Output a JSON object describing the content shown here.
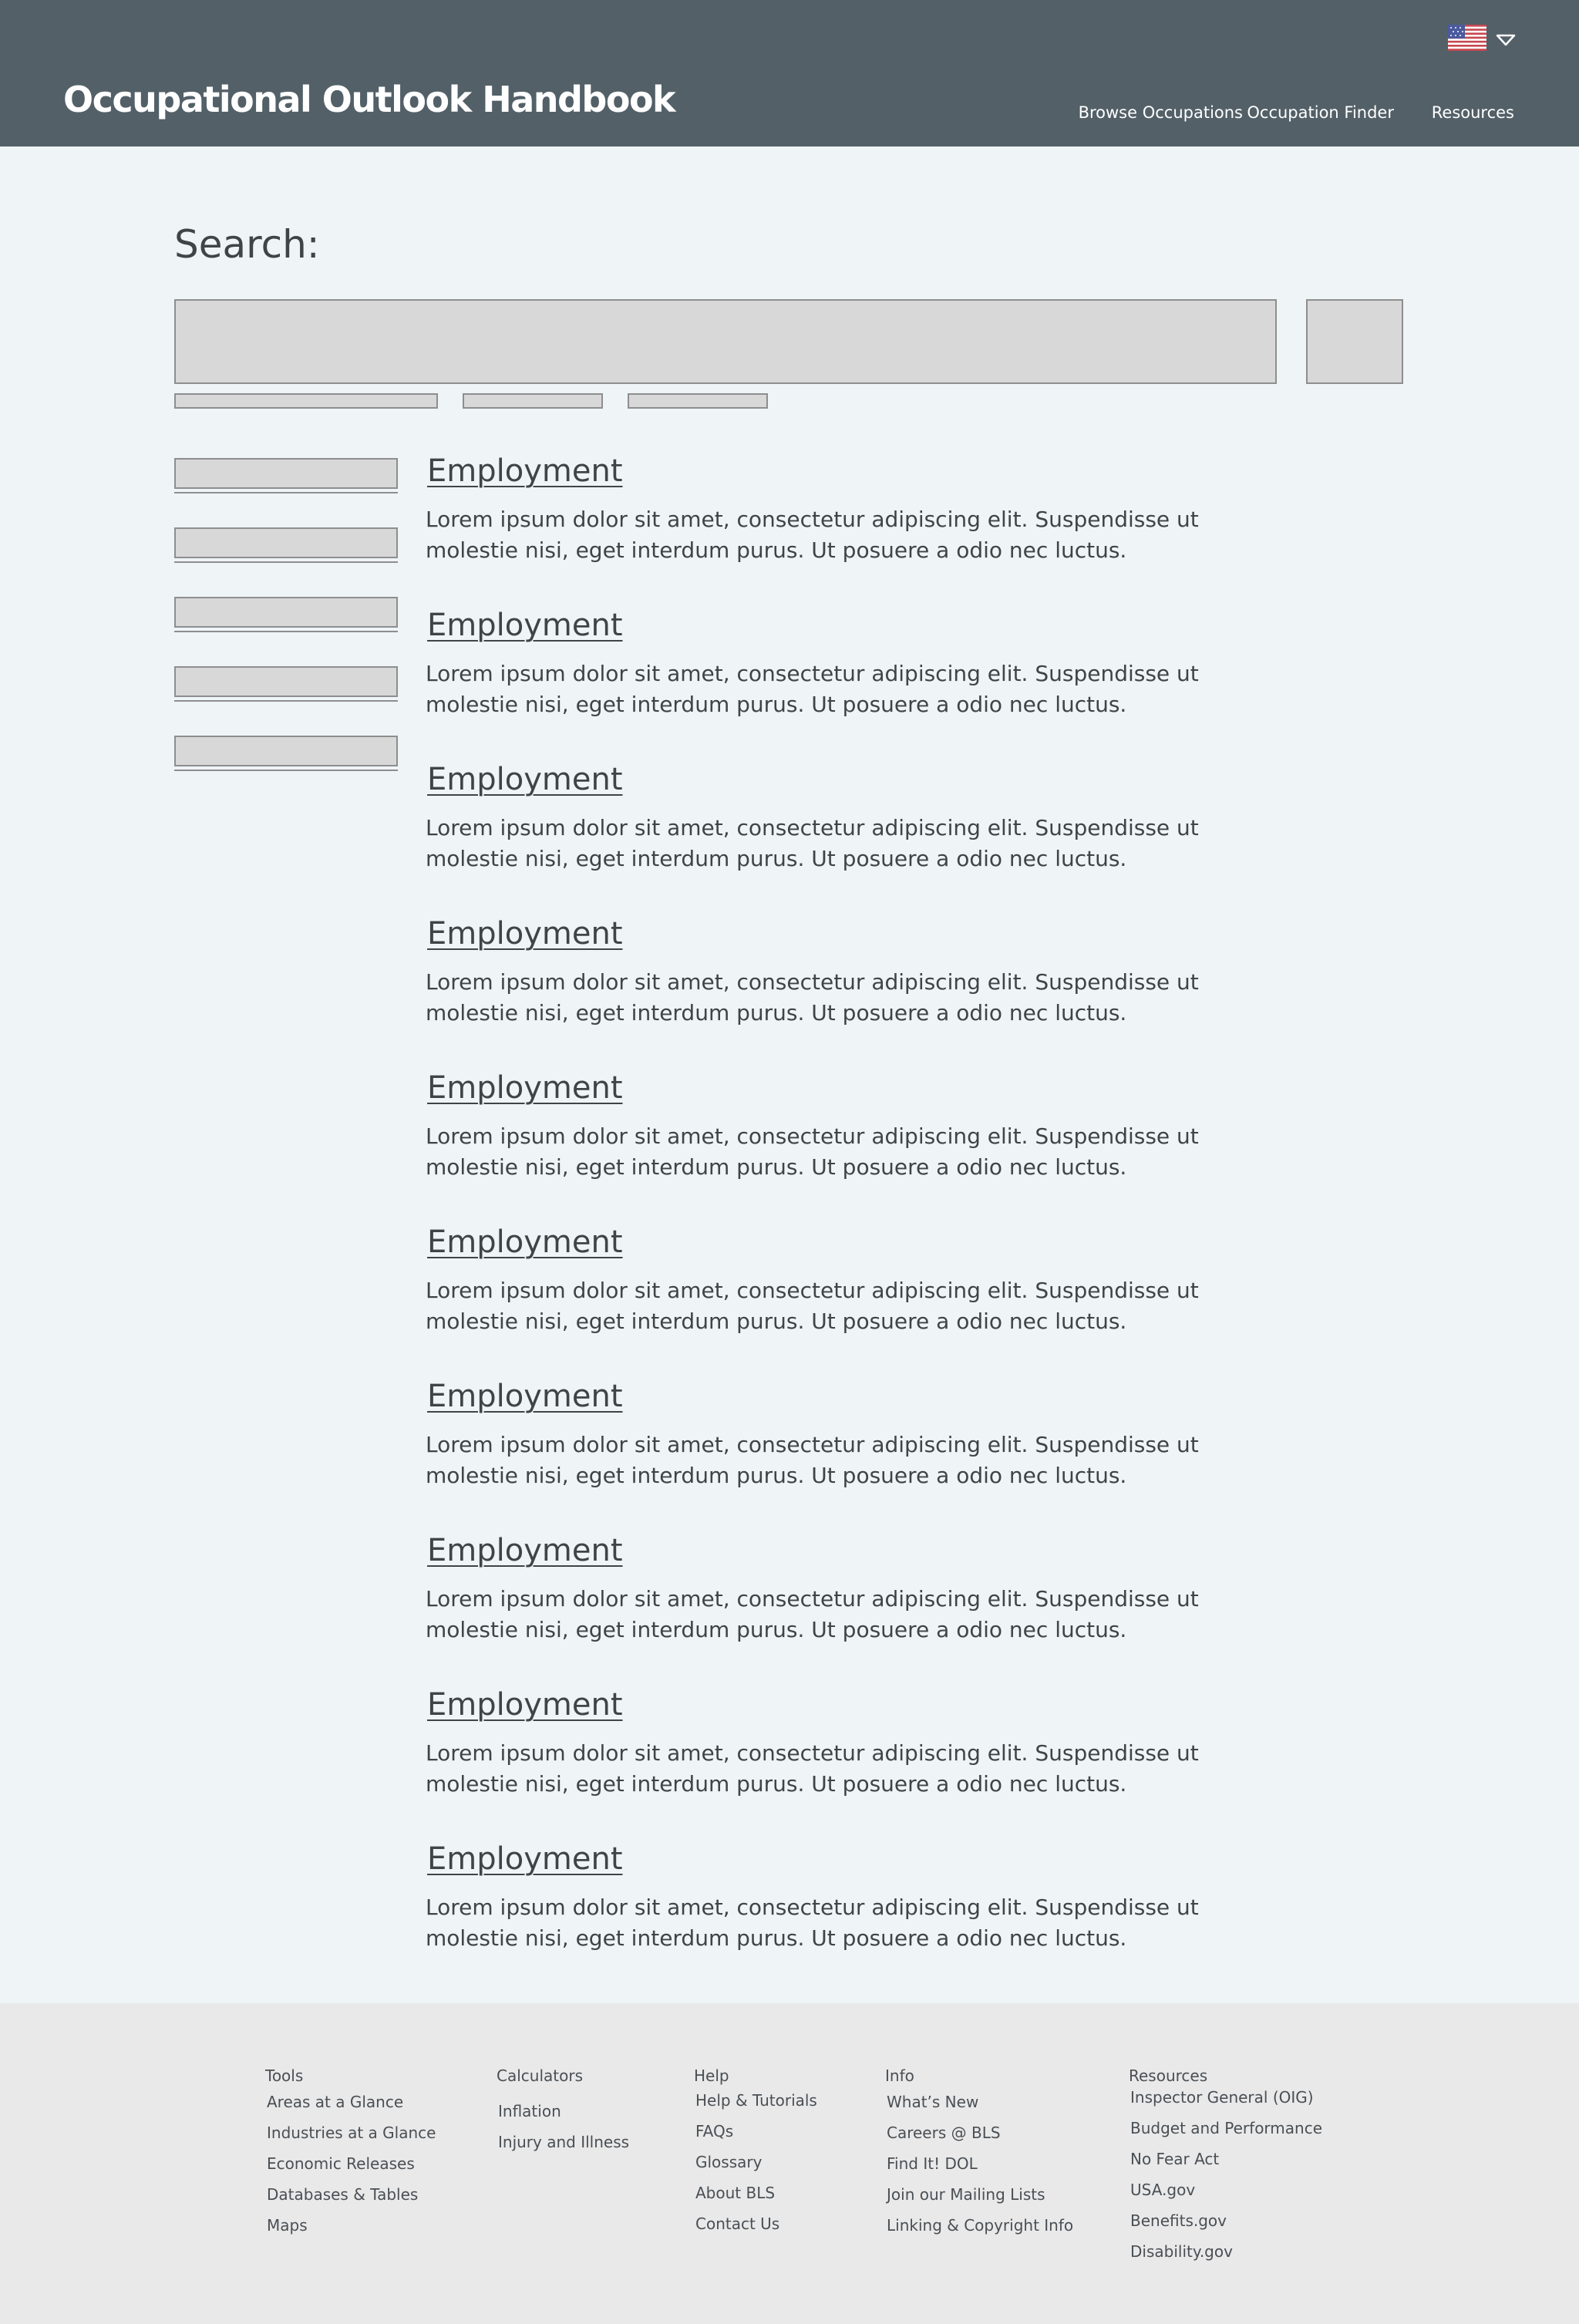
{
  "header": {
    "title": "Occupational Outlook Handbook",
    "nav": [
      "Browse Occupations",
      "Occupation Finder",
      "Resources"
    ]
  },
  "search": {
    "label": "Search:",
    "value": "",
    "placeholder": ""
  },
  "results": [
    {
      "title": "Employment",
      "description": "Lorem ipsum dolor sit amet, consectetur adipiscing elit. Suspendisse ut molestie nisi, eget interdum purus. Ut posuere a odio nec luctus."
    },
    {
      "title": "Employment",
      "description": "Lorem ipsum dolor sit amet, consectetur adipiscing elit. Suspendisse ut molestie nisi, eget interdum purus. Ut posuere a odio nec luctus."
    },
    {
      "title": "Employment",
      "description": "Lorem ipsum dolor sit amet, consectetur adipiscing elit. Suspendisse ut molestie nisi, eget interdum purus. Ut posuere a odio nec luctus."
    },
    {
      "title": "Employment",
      "description": "Lorem ipsum dolor sit amet, consectetur adipiscing elit. Suspendisse ut molestie nisi, eget interdum purus. Ut posuere a odio nec luctus."
    },
    {
      "title": "Employment",
      "description": "Lorem ipsum dolor sit amet, consectetur adipiscing elit. Suspendisse ut molestie nisi, eget interdum purus. Ut posuere a odio nec luctus."
    },
    {
      "title": "Employment",
      "description": "Lorem ipsum dolor sit amet, consectetur adipiscing elit. Suspendisse ut molestie nisi, eget interdum purus. Ut posuere a odio nec luctus."
    },
    {
      "title": "Employment",
      "description": "Lorem ipsum dolor sit amet, consectetur adipiscing elit. Suspendisse ut molestie nisi, eget interdum purus. Ut posuere a odio nec luctus."
    },
    {
      "title": "Employment",
      "description": "Lorem ipsum dolor sit amet, consectetur adipiscing elit. Suspendisse ut molestie nisi, eget interdum purus. Ut posuere a odio nec luctus."
    },
    {
      "title": "Employment",
      "description": "Lorem ipsum dolor sit amet, consectetur adipiscing elit. Suspendisse ut molestie nisi, eget interdum purus. Ut posuere a odio nec luctus."
    },
    {
      "title": "Employment",
      "description": "Lorem ipsum dolor sit amet, consectetur adipiscing elit. Suspendisse ut molestie nisi, eget interdum purus. Ut posuere a odio nec luctus."
    }
  ],
  "footer": {
    "columns": [
      {
        "heading": "Tools",
        "links": [
          "Areas at a Glance",
          "Industries at a Glance",
          "Economic Releases",
          "Databases & Tables",
          "Maps"
        ]
      },
      {
        "heading": "Calculators",
        "links": [
          "Inflation",
          "Injury and Illness"
        ]
      },
      {
        "heading": "Help",
        "links": [
          "Help & Tutorials",
          "FAQs",
          "Glossary",
          "About BLS",
          "Contact Us"
        ]
      },
      {
        "heading": "Info",
        "links": [
          "What’s New",
          "Careers @ BLS",
          "Find It! DOL",
          "Join our Mailing Lists",
          "Linking & Copyright Info"
        ]
      },
      {
        "heading": "Resources",
        "links": [
          "Inspector General (OIG)",
          "Budget and Performance",
          "No Fear Act",
          "USA.gov",
          "Benefits.gov",
          "Disability.gov"
        ]
      }
    ]
  },
  "icons": {
    "flag": "us-flag-icon",
    "language_dropdown": "chevron-down-icon"
  },
  "colors": {
    "header_bg": "#536068",
    "page_bg": "#eff4f7",
    "footer_bg": "#e9e9e9",
    "placeholder_fill": "#d8d8d8",
    "placeholder_border": "#8e8e8e",
    "text": "#3f4448"
  }
}
